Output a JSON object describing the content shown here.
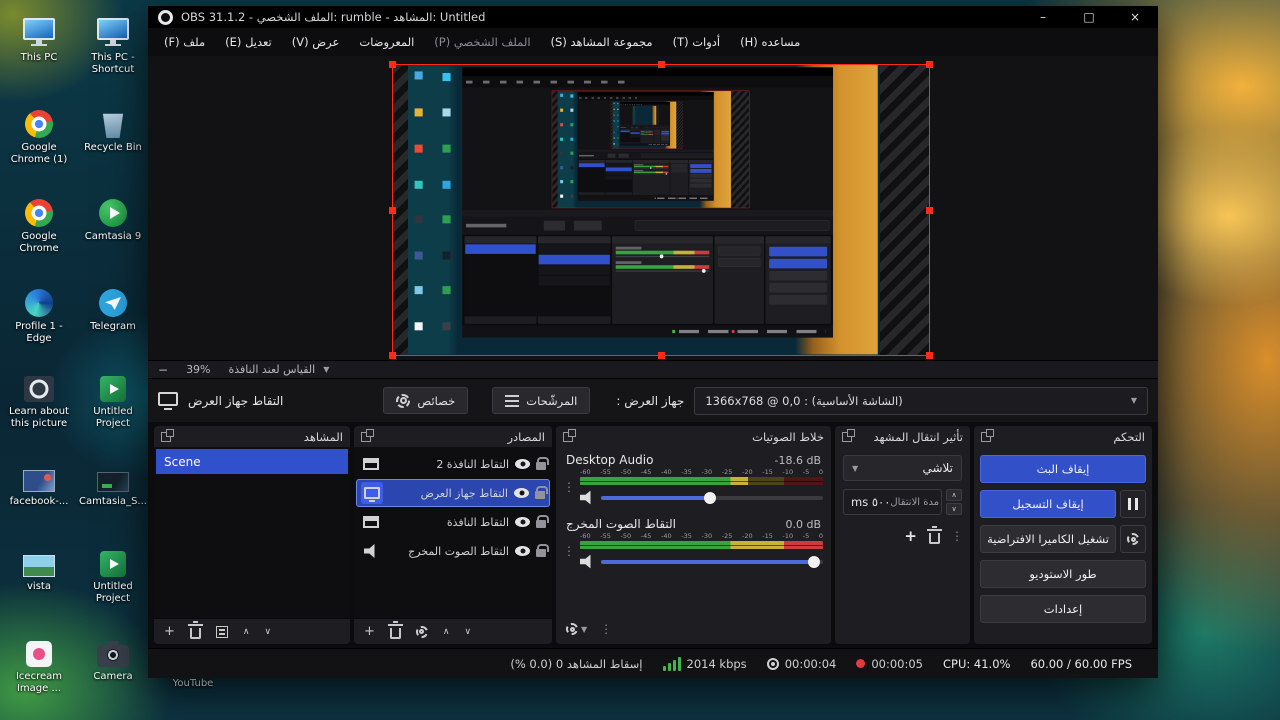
{
  "app": {
    "title": "OBS 31.1.2 - الملف الشخصي: rumble - المشاهد: Untitled",
    "window_controls": {
      "minimize": "–",
      "maximize": "□",
      "close": "×"
    }
  },
  "menu": {
    "items": [
      {
        "label": "ملف (F)",
        "dim": false
      },
      {
        "label": "تعديل (E)",
        "dim": false
      },
      {
        "label": "عرض (V)",
        "dim": false
      },
      {
        "label": "المعروضات",
        "dim": false
      },
      {
        "label": "الملف الشخصي (P)",
        "dim": true
      },
      {
        "label": "مجموعة المشاهد (S)",
        "dim": false
      },
      {
        "label": "أدوات (T)",
        "dim": false
      },
      {
        "label": "مساعده (H)",
        "dim": false
      }
    ]
  },
  "preview": {
    "zoom_percent": "39%",
    "scale_mode": "القياس لعند النافذة"
  },
  "source_toolbar": {
    "selected_source": "التقاط جهاز العرض",
    "properties": "خصائص",
    "filters": "المرشّحات",
    "display_label": "جهاز العرض :",
    "display_value": "(الشاشة الأساسية) : 1366x768 @ 0,0"
  },
  "docks": {
    "scenes": {
      "title": "المشاهد",
      "items": [
        "Scene"
      ]
    },
    "sources": {
      "title": "المصادر",
      "items": [
        {
          "name": "التقاط النافذة 2",
          "type": "window",
          "selected": false
        },
        {
          "name": "التقاط جهاز العرض",
          "type": "display",
          "selected": true
        },
        {
          "name": "التقاط النافذة",
          "type": "window",
          "selected": false
        },
        {
          "name": "التقاط الصوت المخرج",
          "type": "audio",
          "selected": false
        }
      ]
    },
    "mixer": {
      "title": "خلاط الصوتيات",
      "ticks": [
        "-60",
        "-55",
        "-50",
        "-45",
        "-40",
        "-35",
        "-30",
        "-25",
        "-20",
        "-15",
        "-10",
        "-5",
        "0"
      ],
      "channels": [
        {
          "name": "Desktop Audio",
          "db": "-18.6 dB",
          "level_pct": 69,
          "slider_pct": 49
        },
        {
          "name": "التقاط الصوت المخرج",
          "db": "0.0 dB",
          "level_pct": 100,
          "slider_pct": 96
        }
      ]
    },
    "transitions": {
      "title": "تأثير انتقال المشهد",
      "transition": "تلاشي",
      "duration_value": "٥٠٠ ms",
      "duration_label": "مدة الانتقال"
    },
    "controls": {
      "title": "التحكم",
      "stop_stream": "إيقاف البث",
      "stop_record": "إيقاف التسجيل",
      "virtual_camera": "تشغيل الكاميرا الافتراضية",
      "studio_mode": "طور الاستوديو",
      "settings": "إعدادات"
    }
  },
  "statusbar": {
    "dropped_frames": "إسقاط المشاهد 0 (0.0 %)",
    "bitrate": "2014 kbps",
    "stream_time": "00:00:04",
    "record_time": "00:00:05",
    "cpu": "CPU: 41.0%",
    "fps": "60.00 / 60.00 FPS"
  },
  "desktop": {
    "col1": [
      {
        "label": "This PC",
        "icon": "pc"
      },
      {
        "label": "Google Chrome (1)",
        "icon": "chrome"
      },
      {
        "label": "Google Chrome",
        "icon": "chrome"
      },
      {
        "label": "Profile 1 - Edge",
        "icon": "edge"
      },
      {
        "label": "Learn about this picture",
        "icon": "picture"
      },
      {
        "label": "facebook-...",
        "icon": "fbthumb"
      },
      {
        "label": "vista",
        "icon": "photo"
      },
      {
        "label": "Icecream Image ...",
        "icon": "icecream"
      }
    ],
    "col2": [
      {
        "label": "This PC - Shortcut",
        "icon": "pc"
      },
      {
        "label": "Recycle Bin",
        "icon": "bin"
      },
      {
        "label": "Camtasia 9",
        "icon": "camtasia"
      },
      {
        "label": "Telegram",
        "icon": "telegram"
      },
      {
        "label": "Untitled Project",
        "icon": "project"
      },
      {
        "label": "Camtasia_S...",
        "icon": "thumb"
      },
      {
        "label": "Untitled Project",
        "icon": "project"
      },
      {
        "label": "Camera",
        "icon": "camera"
      }
    ],
    "youtube": {
      "label": "YouTube",
      "icon": "youtube"
    }
  },
  "icons": {
    "minus": "−",
    "plus": "+",
    "caret_down": "▼",
    "chevron_up": "∧",
    "chevron_down": "∨",
    "kebab": "⋮",
    "spin_up": "∧",
    "spin_down": "∨"
  },
  "colors": {
    "accent_blue": "#3250c8",
    "selection_red": "#ff2a1a",
    "meter_green": "#36a53e",
    "meter_yellow": "#c9b23a",
    "meter_red": "#cf3b3b",
    "record_red": "#e23b3b"
  }
}
